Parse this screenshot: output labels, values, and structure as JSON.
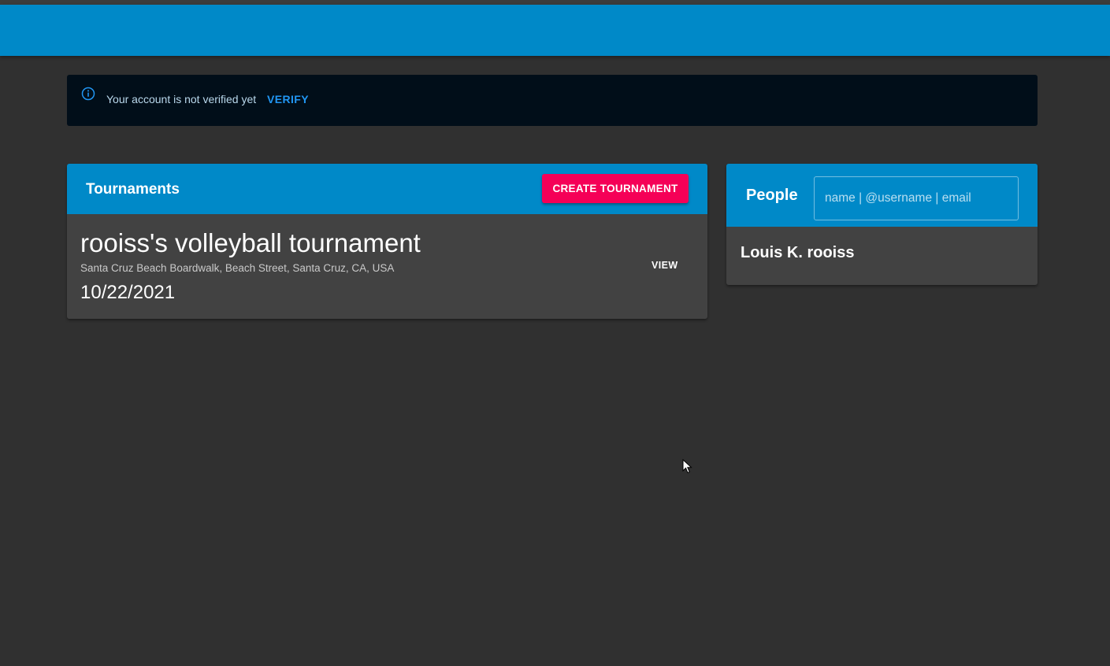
{
  "alert": {
    "message": "Your account is not verified yet",
    "action_label": "VERIFY",
    "icon": "info-icon"
  },
  "tournaments": {
    "title": "Tournaments",
    "create_label": "CREATE TOURNAMENT",
    "items": [
      {
        "name": "rooiss's volleyball tournament",
        "location": "Santa Cruz Beach Boardwalk, Beach Street, Santa Cruz, CA, USA",
        "date": "10/22/2021",
        "view_label": "VIEW"
      }
    ]
  },
  "people": {
    "title": "People",
    "search_placeholder": "name | @username | email",
    "items": [
      {
        "name": "Louis K. rooiss"
      }
    ]
  },
  "colors": {
    "app_bar": "#0089c8",
    "background": "#303030",
    "card": "#424242",
    "accent_button": "#f50057",
    "link": "#2196f3",
    "alert_bg": "#010e19"
  }
}
